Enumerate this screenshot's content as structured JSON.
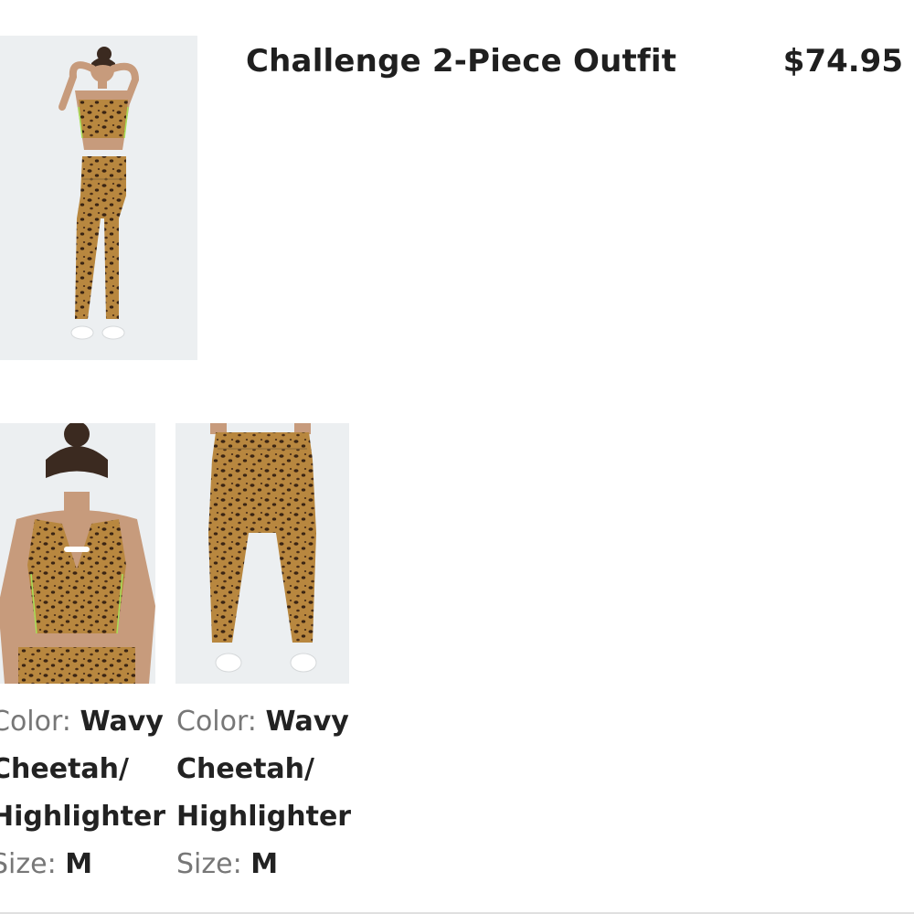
{
  "product": {
    "title": "Challenge 2-Piece Outfit",
    "price": "$74.95"
  },
  "images": {
    "main": "woman-wearing-leopard-outfit-front",
    "top": "leopard-sports-bra-back-view",
    "bottom": "leopard-leggings-back-view"
  },
  "items": [
    {
      "color_label": "Color: ",
      "color_line_1": "Wavy",
      "color_line_2": "Cheetah/",
      "color_line_3": "Highlighter",
      "size_label": "Size: ",
      "size_value": "M"
    },
    {
      "color_label": "Color: ",
      "color_line_1": "Wavy",
      "color_line_2": "Cheetah/",
      "color_line_3": "Highlighter",
      "size_label": "Size: ",
      "size_value": "M"
    }
  ],
  "colors": {
    "accent": "#B8873F",
    "highlighter": "#A8E05A",
    "text": "#222222",
    "label": "#777777"
  }
}
